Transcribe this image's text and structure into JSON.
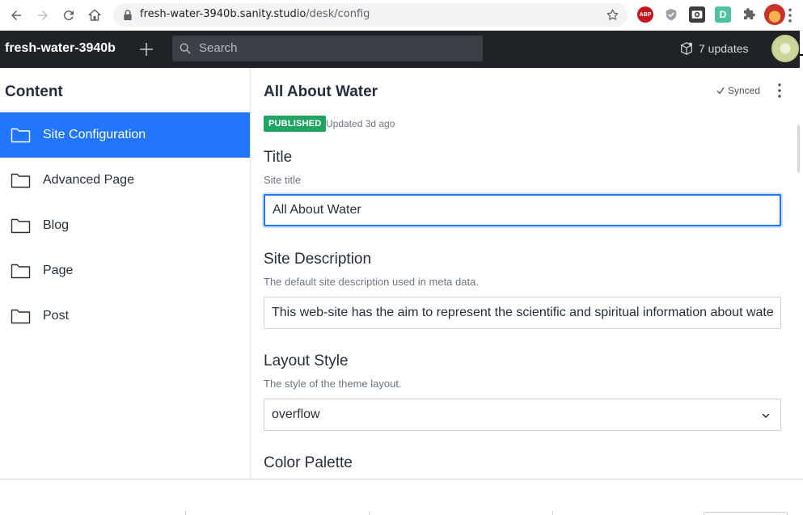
{
  "browser": {
    "url_host": "fresh-water-3940b.sanity.studio",
    "url_path": "/desk/config",
    "extensions": [
      "abp-icon",
      "shield-extension-icon",
      "camera-extension-icon",
      "d-extension-icon",
      "puzzle-icon",
      "profile-icon"
    ],
    "abp_label": "ABP",
    "d_label": "D"
  },
  "navbar": {
    "project_title": "fresh-water-3940b",
    "search_placeholder": "Search",
    "updates_label": "7 updates"
  },
  "content_pane": {
    "title": "Content",
    "items": [
      {
        "label": "Site Configuration",
        "active": true
      },
      {
        "label": "Advanced Page",
        "active": false
      },
      {
        "label": "Blog",
        "active": false
      },
      {
        "label": "Page",
        "active": false
      },
      {
        "label": "Post",
        "active": false
      }
    ]
  },
  "document": {
    "title": "All About Water",
    "sync_status": "Synced",
    "status_badge": "PUBLISHED",
    "updated_text": "Updated 3d ago",
    "fields": {
      "title": {
        "label": "Title",
        "description": "Site title",
        "value": "All About Water"
      },
      "site_description": {
        "label": "Site Description",
        "description": "The default site description used in meta data.",
        "value": "This web-site has the aim to represent the scientific and spiritual information about water"
      },
      "layout_style": {
        "label": "Layout Style",
        "description": "The style of the theme layout.",
        "value": "overflow"
      },
      "color_palette": {
        "label": "Color Palette"
      }
    }
  },
  "colors": {
    "accent": "#2276fc",
    "navbar_bg": "#1f2227",
    "published": "#1fa463"
  }
}
